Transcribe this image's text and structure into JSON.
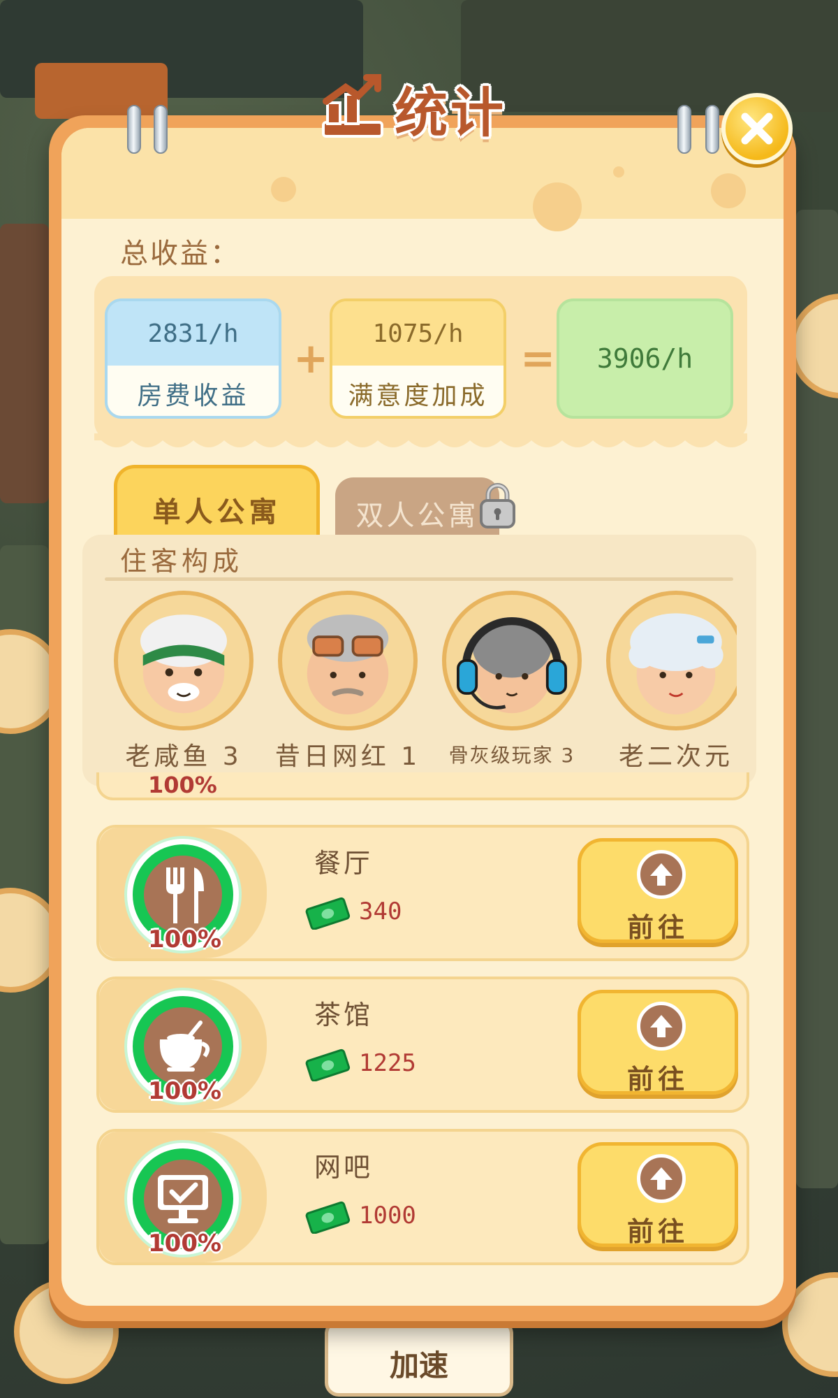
{
  "title": "统计",
  "close_label": "close",
  "income": {
    "label": "总收益：",
    "room": {
      "value": "2831/h",
      "label": "房费收益"
    },
    "plus": "+",
    "satisfaction": {
      "value": "1075/h",
      "label": "满意度加成"
    },
    "equals": "=",
    "total": "3906/h"
  },
  "tabs": [
    {
      "label": "单人公寓",
      "selected": true,
      "locked": false
    },
    {
      "label": "双人公寓",
      "selected": false,
      "locked": true
    }
  ],
  "residents": {
    "title": "住客构成",
    "items": [
      {
        "name": "老咸鱼 3"
      },
      {
        "name": "昔日网红 1"
      },
      {
        "name": "骨灰级玩家 3"
      },
      {
        "name": "老二次元"
      }
    ]
  },
  "peek_row": {
    "pct": "100%"
  },
  "facilities": [
    {
      "name": "餐厅",
      "value": "340",
      "pct": "100%",
      "icon": "fork-knife-icon",
      "button": "前往"
    },
    {
      "name": "茶馆",
      "value": "1225",
      "pct": "100%",
      "icon": "teapot-icon",
      "button": "前往"
    },
    {
      "name": "网吧",
      "value": "1000",
      "pct": "100%",
      "icon": "computer-icon",
      "button": "前往"
    }
  ],
  "bottom_button": "加速",
  "colors": {
    "panel": "#f0a35a",
    "progress": "#17c653",
    "value_red": "#b13a34"
  }
}
